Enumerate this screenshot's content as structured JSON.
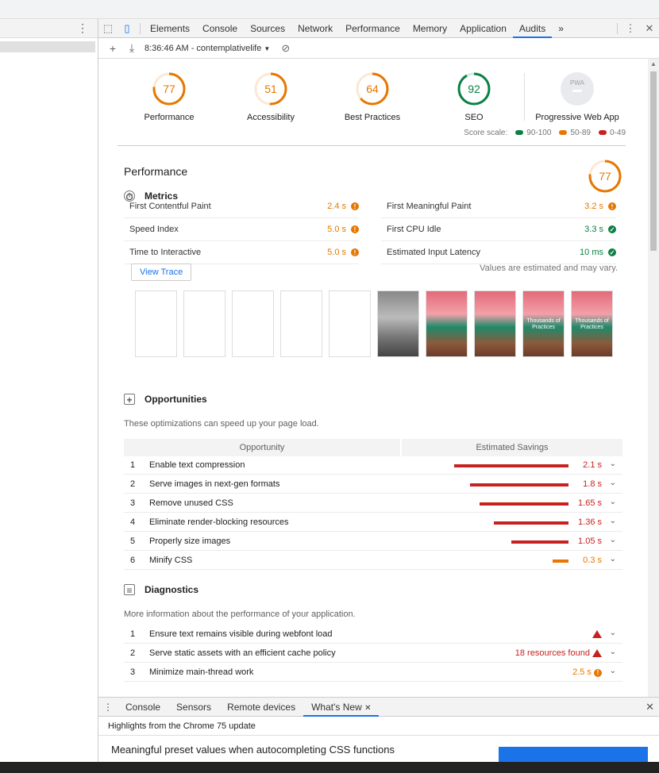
{
  "devtools": {
    "tabs": [
      "Elements",
      "Console",
      "Sources",
      "Network",
      "Performance",
      "Memory",
      "Application",
      "Audits"
    ],
    "active_tab": "Audits",
    "more_tabs_icon": "»",
    "report_select": "8:36:46 AM - contemplativelife",
    "report_select_caret": "▼"
  },
  "categories": [
    {
      "label": "Performance",
      "score": "77",
      "color": "#e67700"
    },
    {
      "label": "Accessibility",
      "score": "51",
      "color": "#e67700"
    },
    {
      "label": "Best Practices",
      "score": "64",
      "color": "#e67700"
    },
    {
      "label": "SEO",
      "score": "92",
      "color": "#0b8043"
    },
    {
      "label": "Progressive Web App",
      "badge": "PWA"
    }
  ],
  "score_scale": {
    "label": "Score scale:",
    "good": "90-100",
    "average": "50-89",
    "fail": "0-49"
  },
  "performance": {
    "title": "Performance",
    "score": "77",
    "metrics_title": "Metrics",
    "metrics": [
      {
        "label": "First Contentful Paint",
        "value": "2.4 s",
        "status": "orange"
      },
      {
        "label": "First Meaningful Paint",
        "value": "3.2 s",
        "status": "orange"
      },
      {
        "label": "Speed Index",
        "value": "5.0 s",
        "status": "orange"
      },
      {
        "label": "First CPU Idle",
        "value": "3.3 s",
        "status": "green"
      },
      {
        "label": "Time to Interactive",
        "value": "5.0 s",
        "status": "orange"
      },
      {
        "label": "Estimated Input Latency",
        "value": "10 ms",
        "status": "green"
      }
    ],
    "estimated_note": "Values are estimated and may vary.",
    "view_trace": "View Trace",
    "frame_caption": "Thousands of Practices"
  },
  "opportunities": {
    "title": "Opportunities",
    "description": "These optimizations can speed up your page load.",
    "col_opportunity": "Opportunity",
    "col_savings": "Estimated Savings",
    "rows": [
      {
        "n": "1",
        "label": "Enable text compression",
        "value": "2.1 s",
        "fraction": 1.0,
        "color": "#c7221f"
      },
      {
        "n": "2",
        "label": "Serve images in next-gen formats",
        "value": "1.8 s",
        "fraction": 0.86,
        "color": "#c7221f"
      },
      {
        "n": "3",
        "label": "Remove unused CSS",
        "value": "1.65 s",
        "fraction": 0.78,
        "color": "#c7221f"
      },
      {
        "n": "4",
        "label": "Eliminate render-blocking resources",
        "value": "1.36 s",
        "fraction": 0.65,
        "color": "#c7221f"
      },
      {
        "n": "5",
        "label": "Properly size images",
        "value": "1.05 s",
        "fraction": 0.5,
        "color": "#c7221f"
      },
      {
        "n": "6",
        "label": "Minify CSS",
        "value": "0.3 s",
        "fraction": 0.14,
        "color": "#e67700"
      }
    ]
  },
  "diagnostics": {
    "title": "Diagnostics",
    "description": "More information about the performance of your application.",
    "rows": [
      {
        "n": "1",
        "label": "Ensure text remains visible during webfont load",
        "value": "",
        "status": "red"
      },
      {
        "n": "2",
        "label": "Serve static assets with an efficient cache policy",
        "value": "18 resources found",
        "status": "red"
      },
      {
        "n": "3",
        "label": "Minimize main-thread work",
        "value": "2.5 s",
        "status": "orange"
      }
    ]
  },
  "drawer": {
    "tabs": [
      "Console",
      "Sensors",
      "Remote devices",
      "What's New"
    ],
    "active_tab": "What's New",
    "highlight": "Highlights from the Chrome 75 update",
    "body_title": "Meaningful preset values when autocompleting CSS functions"
  }
}
